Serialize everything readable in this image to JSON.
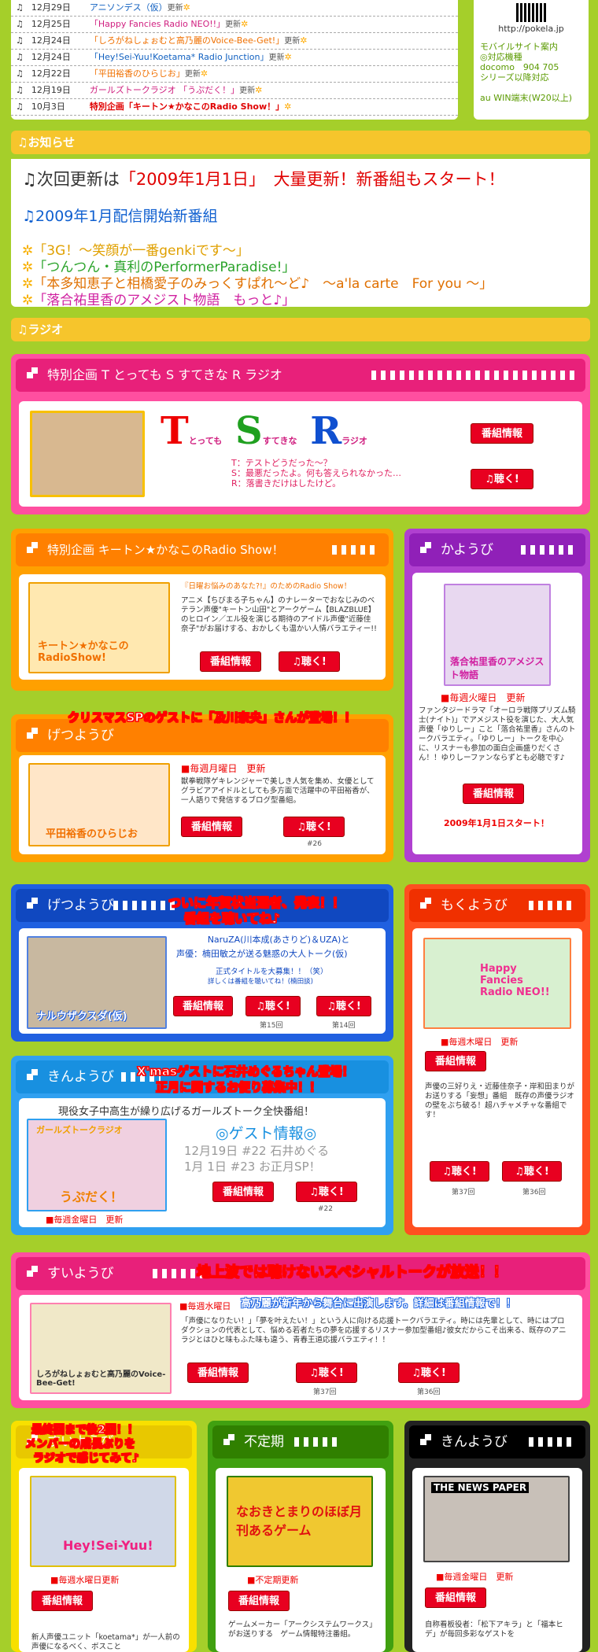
{
  "updates": [
    {
      "date": "12月29日",
      "title": "アニソンデス（仮）",
      "color": "b",
      "tag": "更新"
    },
    {
      "date": "12月25日",
      "title": "「Happy Fancies Radio NEO!!」",
      "color": "p",
      "tag": "更新"
    },
    {
      "date": "12月24日",
      "title": "「しろがねしょぉむと高乃麗のVoice-Bee-Get!」",
      "color": "",
      "tag": "更新"
    },
    {
      "date": "12月24日",
      "title": "「Hey!Sei-Yuu!Koetama* Radio Junction」",
      "color": "b",
      "tag": "更新"
    },
    {
      "date": "12月22日",
      "title": "「平田裕香のひらじお」",
      "color": "",
      "tag": "更新"
    },
    {
      "date": "12月19日",
      "title": "ガールズトークラジオ 「うぷだく！」",
      "color": "p",
      "tag": "更新"
    },
    {
      "date": "10月3日",
      "title": "特別企画「キートン★かなこのRadio Show！」",
      "color": "r",
      "tag": ""
    }
  ],
  "qr": {
    "url": "http://pokela.jp",
    "lines": [
      "モバイルサイト案内",
      "◎対応機種",
      "docomo　904 705",
      "シリーズ以降対応",
      "",
      "au WIN端末(W20以上)"
    ]
  },
  "bars": {
    "news": "お知らせ",
    "radio": "ラジオ"
  },
  "news": {
    "headline_pre": "次回更新は",
    "headline_date": "「2009年1月1日」",
    "headline_post": "　大量更新！新番組もスタート！",
    "sub": "2009年1月配信開始新番組",
    "items": [
      {
        "text": "「3G！～笑顔が一番genkiです～」",
        "color": "#e0a000"
      },
      {
        "text": "「つんつん・真利のPerformerParadise!」",
        "color": "#2aa32a"
      },
      {
        "text": "「本多知恵子と相橋愛子のみっくすぱれ～ど♪　～a'la carte　For you ～」",
        "color": "#e07000"
      },
      {
        "text": "「落合祐里香のアメジスト物語　もっと♪」",
        "color": "#d020a0"
      }
    ]
  },
  "tsr": {
    "header": "特別企画 T とっても S すてきな R ラジオ",
    "logo_t": "T",
    "logo_s": "S",
    "logo_r": "R",
    "logo_t_sub": "とっても",
    "logo_s_sub": "すてきな",
    "logo_r_sub": "ラジオ",
    "lines": [
      "T：テストどうだった～？",
      "S：最悪だったよ。何も答えられなかった…",
      "R：落書きだけはしたけど。"
    ],
    "btn_info": "番組情報",
    "btn_listen": "♫聴く!"
  },
  "keaton": {
    "header": "特別企画 キートン★かなこのRadio Show！",
    "thumb_label": "キートン★かなこのRadioShow!",
    "title": "『日曜お悩みのあなた?!』のためのRadio Show！",
    "desc": "アニメ【ちびまる子ちゃん】のナレーターでおなじみのベテラン声優\"キートン山田\"とアークゲーム【BLAZBLUE】のヒロイン／エル役を演じる期待のアイドル声優\"近藤佳奈子\"がお届けする、おかしくも温かい人情バラエティー!!",
    "btn_info": "番組情報",
    "btn_listen": "♫聴く!"
  },
  "tue": {
    "header": "かようび",
    "thumb_label": "落合祐里香のアメジスト物語",
    "schedule": "■毎週火曜日　更新",
    "desc": "ファンタジードラマ「オーロラ戦隊プリズム騎士(ナイト)」でアメジスト役を演じた、大人気声優「ゆりしー」こと「落合祐里香」さんのトークバラエティ。「ゆりしー」トークを中心に、リスナーも参加の面白企画盛りだくさん！！ゆりしーファンならずとも必聴です♪",
    "btn_info": "番組情報",
    "start": "2009年1月1日スタート！"
  },
  "mon": {
    "header": "げつようび",
    "anno": "クリスマスSPのゲストに「及川奈央」さんが登場！！",
    "thumb_label": "平田裕香のひらじお",
    "schedule": "■毎週月曜日　更新",
    "desc": "獣拳戦隊ゲキレンジャーで美しき人気を集め、女優としてグラビアアイドルとしても多方面で活躍中の平田裕香が、一人語りで発信するブログ型番組。",
    "btn_info": "番組情報",
    "btn_listen": "♫聴く!",
    "ep": "#26"
  },
  "mon2": {
    "header": "げつようび",
    "anno1": "ついに年賀状当選者、発表！！",
    "anno2": "番組を聴いてね♪",
    "thumb_label": "ナルウザクスダ(仮)",
    "desc1": "NaruZA(川本成(あさりど)＆UZA)と",
    "desc2": "声優：楠田敏之が送る魅惑の大人トーク(仮)",
    "note1": "正式タイトルを大募集！！（笑）",
    "note2": "詳しくは番組を聴いてね！(楠田談)",
    "btn_info": "番組情報",
    "btn_listen": "♫聴く!",
    "ep1": "第15回",
    "ep2": "第14回"
  },
  "thu": {
    "header": "もくようび",
    "thumb_label": "Happy Fancies Radio NEO!!",
    "schedule": "■毎週木曜日　更新",
    "desc": "声優の三好りえ・近藤佳奈子・岸和田まりがお送りする「妄想」番組　既存の声優ラジオの壁をぶち破る！超ハチャメチャな番組です！",
    "btn_info": "番組情報",
    "btn_listen": "♫聴く!",
    "ep1": "第37回",
    "ep2": "第36回"
  },
  "fri": {
    "header": "きんようび",
    "anno1": "X'masゲストに石井めぐるちゃん登場！",
    "anno2": "正月に関するお便り募集中！！",
    "title": "現役女子中高生が繰り広げるガールズトーク全快番組！",
    "thumb_label": "うぷだく！",
    "thumb_top": "ガールズトークラジオ",
    "guest_title": "◎ゲスト情報◎",
    "guest1": "12月19日 #22 石井めぐる",
    "guest2": "1月 1日 #23 お正月SP！",
    "schedule": "■毎週金曜日　更新",
    "btn_info": "番組情報",
    "btn_listen": "♫聴く!",
    "ep": "#22"
  },
  "wed": {
    "header": "すいようび",
    "anno": "地上波では聴けないスペシャルトークが放送！！",
    "anno2": "高乃麗が新年から舞台に出演します。詳細は番組情報で！！",
    "schedule": "■毎週水曜日",
    "thumb_label": "しろがねしょぉむと高乃麗のVoice-Bee-Get!",
    "desc": "「声優になりたい！」「夢を叶えたい！」という人に向ける応援トークバラエティ。時には先輩として、時にはプロダクションの代表として、悩める若者たちの夢を応援するリスナー参加型番組♪彼女だからこそ出来る、既存のアニラジとはひと味もふた味も違う、青春王道応援バラエティ！！",
    "btn_info": "番組情報",
    "btn_listen": "♫聴く!",
    "ep1": "第37回",
    "ep2": "第36回"
  },
  "wed2": {
    "header": "すいようび",
    "anno1": "最終回まで後2回！！",
    "anno2": "メンバーの成長ぶりを",
    "anno3": "ラジオで感じてみて♪",
    "thumb_label": "Hey!Sei-Yuu!",
    "schedule": "■毎週水曜日更新",
    "btn_info": "番組情報",
    "desc": "新人声優ユニット「koetama*」が一人前の声優になるべく、ボスこと"
  },
  "irr": {
    "header": "不定期",
    "thumb_label": "なおきとまりのほぼ月刊あるゲーム",
    "schedule": "■不定期更新",
    "btn_info": "番組情報",
    "desc": "ゲームメーカー「アークシステムワークス」がお送りする　ゲーム情報特注番組。"
  },
  "fri2": {
    "header": "きんようび",
    "thumb_label": "THE NEWS PAPER",
    "schedule": "■毎週金曜日　更新",
    "btn_info": "番組情報",
    "desc": "自称看板役者：「松下アキラ」と「福本ヒデ」が毎回多彩なゲストを"
  }
}
